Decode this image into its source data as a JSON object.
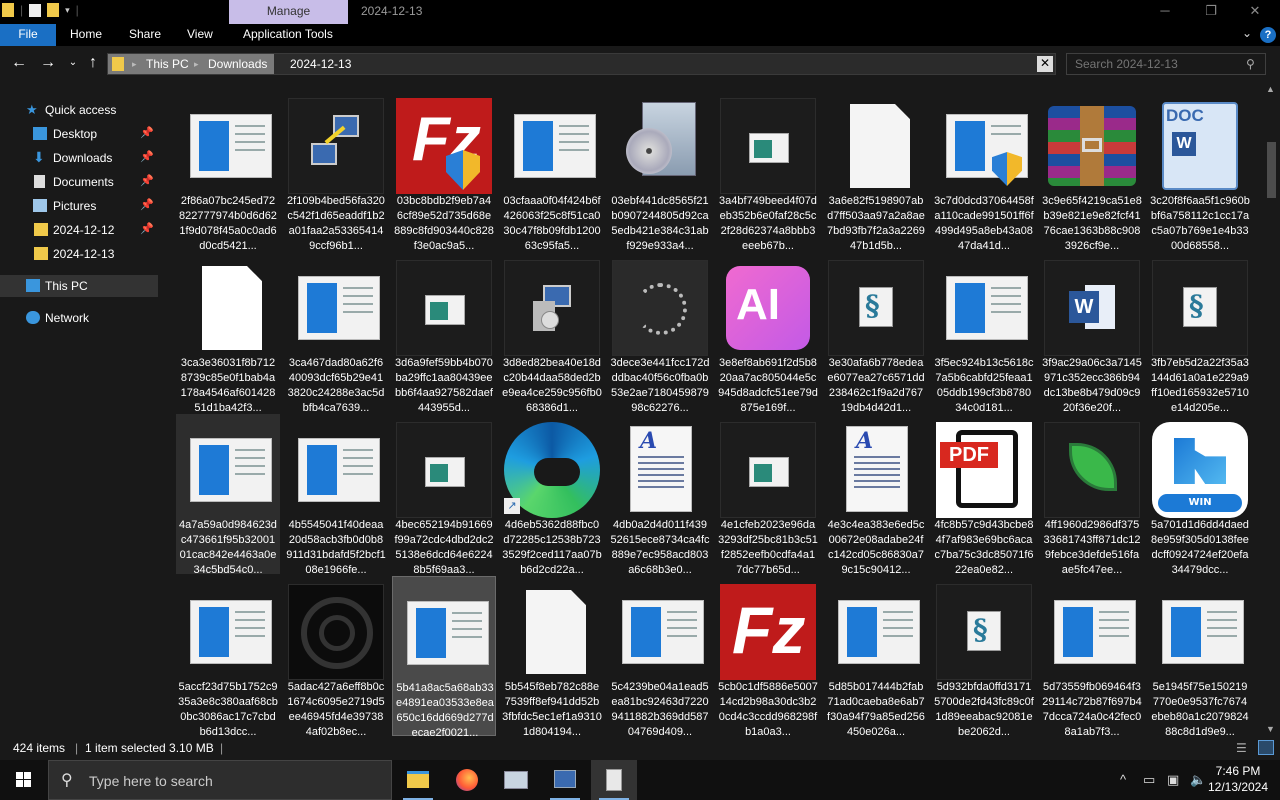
{
  "titlebar": {
    "manage_tab": "Manage",
    "title": "2024-12-13",
    "minimize": "─",
    "restore": "❐",
    "close": "✕"
  },
  "ribbon": {
    "tabs": [
      "File",
      "Home",
      "Share",
      "View",
      "Application Tools"
    ],
    "help": "?"
  },
  "address": {
    "crumbs": [
      "This PC",
      "Downloads",
      "2024-12-13"
    ],
    "search_placeholder": "Search 2024-12-13"
  },
  "sidebar": {
    "items": [
      {
        "label": "Quick access",
        "icon": "star-icon"
      },
      {
        "label": "Desktop",
        "icon": "desktop-icon",
        "pinned": true
      },
      {
        "label": "Downloads",
        "icon": "download-icon",
        "pinned": true
      },
      {
        "label": "Documents",
        "icon": "documents-icon",
        "pinned": true
      },
      {
        "label": "Pictures",
        "icon": "pictures-icon",
        "pinned": true
      },
      {
        "label": "2024-12-12",
        "icon": "folder-icon",
        "pinned": true
      },
      {
        "label": "2024-12-13",
        "icon": "folder-icon"
      },
      {
        "label": "This PC",
        "icon": "computer-icon"
      },
      {
        "label": "Network",
        "icon": "network-icon"
      }
    ]
  },
  "files": [
    {
      "name": "2f86a07bc245ed72822777974b0d6d621f9d078f45a0c0ad6d0cd5421...",
      "icon": "app-window"
    },
    {
      "name": "2f109b4bed56fa320c542f1d65eaddf1b2a01faa2a533654149ccf96b1...",
      "icon": "network-transfer"
    },
    {
      "name": "03bc8bdb2f9eb7a46cf89e52d735d68e889c8fd903440c828f3e0ac9a5...",
      "icon": "filezilla-shield"
    },
    {
      "name": "03cfaaa0f04f424b6f426063f25c8f51ca030c47f8b09fdb120063c95fa5...",
      "icon": "app-window"
    },
    {
      "name": "03ebf441dc8565f21b0907244805d92ca5edb421e384c31abf929e933a4...",
      "icon": "installer-cd"
    },
    {
      "name": "3a4bf749beed4f07deb352b6e0faf28c5c2f28d62374a8bbb3eeeb67b...",
      "icon": "small-window"
    },
    {
      "name": "3a6e82f5198907abd7ff503aa97a2a8ae7bd93fb7f2a3a226947b1d5b...",
      "icon": "blank-file"
    },
    {
      "name": "3c7d0dcd37064458fa110cade991501ff6f499d495a8eb43a0847da41d...",
      "icon": "app-window-shield"
    },
    {
      "name": "3c9e65f4219ca51e8b39e821e9e82fcf4176cae1363b88c9083926cf9e...",
      "icon": "winrar"
    },
    {
      "name": "3c20f8f6aa5f1c960bbf6a758112c1cc17ac5a07b769e1e4b3300d68558...",
      "icon": "word-doc"
    },
    {
      "name": "3ca3e36031f8b7128739c85e0f1bab4a178a4546af60142851d1ba42f3...",
      "icon": "blank-doc"
    },
    {
      "name": "3ca467dad80a62f640093dcf65b29e413820c24288e3ac5dbfb4ca7639...",
      "icon": "app-window"
    },
    {
      "name": "3d6a9fef59bb4b070ba29ffc1aa80439eebb6f4aa927582daef443955d...",
      "icon": "small-window"
    },
    {
      "name": "3d8ed82bea40e18dc20b44daa58ded2be9ea4ce259c956fb068386d1...",
      "icon": "installer-pc"
    },
    {
      "name": "3dece3e441fcc172dddbac40f56c0fba0b53e2ae718045987998c62276...",
      "icon": "dots-swirl"
    },
    {
      "name": "3e8ef8ab691f2d5b820aa7ac805044e5c945d8adcfc51ee79d875e169f...",
      "icon": "adobe-ai"
    },
    {
      "name": "3e30afa6b778edeae6077ea27c6571dd238462c1f9a2d76719db4d42d1...",
      "icon": "script"
    },
    {
      "name": "3f5ec924b13c5618c7a5b6cabfd25feaa105ddb199cf3b878034c0d181...",
      "icon": "app-window"
    },
    {
      "name": "3f9ac29a06c3a7145971c352ecc386b94dc13be8b479d09c920f36e20f...",
      "icon": "word-app"
    },
    {
      "name": "3fb7eb5d2a22f35a3144d61a0a1e229a9ff10ed165932e5710e14d205e...",
      "icon": "script"
    },
    {
      "name": "4a7a59a0d984623dc473661f95b3200101cac842e4463a0e34c5bd54c0...",
      "icon": "app-window"
    },
    {
      "name": "4b5545041f40deaa20d58acb3fb0d0b8911d31bdafd5f2bcf108e1966fe...",
      "icon": "app-window"
    },
    {
      "name": "4bec652194b91669f99a72cdc4dbd2dc25138e6dcd64e62248b5f69aa3...",
      "icon": "small-window"
    },
    {
      "name": "4d6eb5362d88fbc0d72285c12538b7233529f2ced117aa07bb6d2cd22a...",
      "icon": "edge"
    },
    {
      "name": "4db0a2d4d011f43952615ece8734ca4fc889e7ec958acd803a6c68b3e0...",
      "icon": "text-doc"
    },
    {
      "name": "4e1cfeb2023e96da3293df25bc81b3c51f2852eefb0cdfa4a17dc77b65d...",
      "icon": "small-window"
    },
    {
      "name": "4e3c4ea383e6ed5c00672e08adabe24fc142cd05c86830a79c15c90412...",
      "icon": "text-doc"
    },
    {
      "name": "4fc8b57c9d43bcbe84f7af983e69bc6acac7ba75c3dc85071f622ea0e82...",
      "icon": "pdf"
    },
    {
      "name": "4ff1960d2986df37533681743ff871dc129febce3defde516faae5fc47ee...",
      "icon": "leaf"
    },
    {
      "name": "5a701d1d6dd4daed8e959f305d0138feedcff0924724ef20efa34479dcc...",
      "icon": "win-helper"
    },
    {
      "name": "5accf23d75b1752c935a3e8c380aaf68cb0bc3086ac17c7cbdb6d13dcc...",
      "icon": "app-window"
    },
    {
      "name": "5adac427a6eff8b0c1674c6095e2719d5ee46945fd4e397384af02b8ec...",
      "icon": "dark-wheel"
    },
    {
      "name": "5b41a8ac5a68ab33e4891ea03533e8ea650c16dd669d277decae2f0021...",
      "icon": "app-window"
    },
    {
      "name": "5b545f8eb782c88e7539ff8ef941dd52b3fbfdc5ec1ef1a93101d804194...",
      "icon": "blank-file"
    },
    {
      "name": "5c4239be04a1ead5ea81bc92463d72209411882b369dd58704769d409...",
      "icon": "app-window"
    },
    {
      "name": "5cb0c1df5886e500714cd2b98a30dc3b20cd4c3ccdd968298fb1a0a3...",
      "icon": "filezilla"
    },
    {
      "name": "5d85b017444b2fab71ad0caeba8e6ab7f30a94f79a85ed256450e026a...",
      "icon": "app-window"
    },
    {
      "name": "5d932bfda0ffd31715700de2fd43fc89c0f1d89eeabac92081ebe2062d...",
      "icon": "script"
    },
    {
      "name": "5d73559fb069464f329114c72b87f697b47dcca724a0c42fec08a1ab7f3...",
      "icon": "app-window"
    },
    {
      "name": "5e1945f75e150219770e0e9537fc7674ebeb80a1c207982488c8d1d9e9...",
      "icon": "app-window"
    }
  ],
  "status": {
    "count": "424 items",
    "selected": "1 item selected  3.10 MB"
  },
  "taskbar": {
    "search_placeholder": "Type here to search",
    "time": "7:46 PM",
    "date": "12/13/2024"
  }
}
